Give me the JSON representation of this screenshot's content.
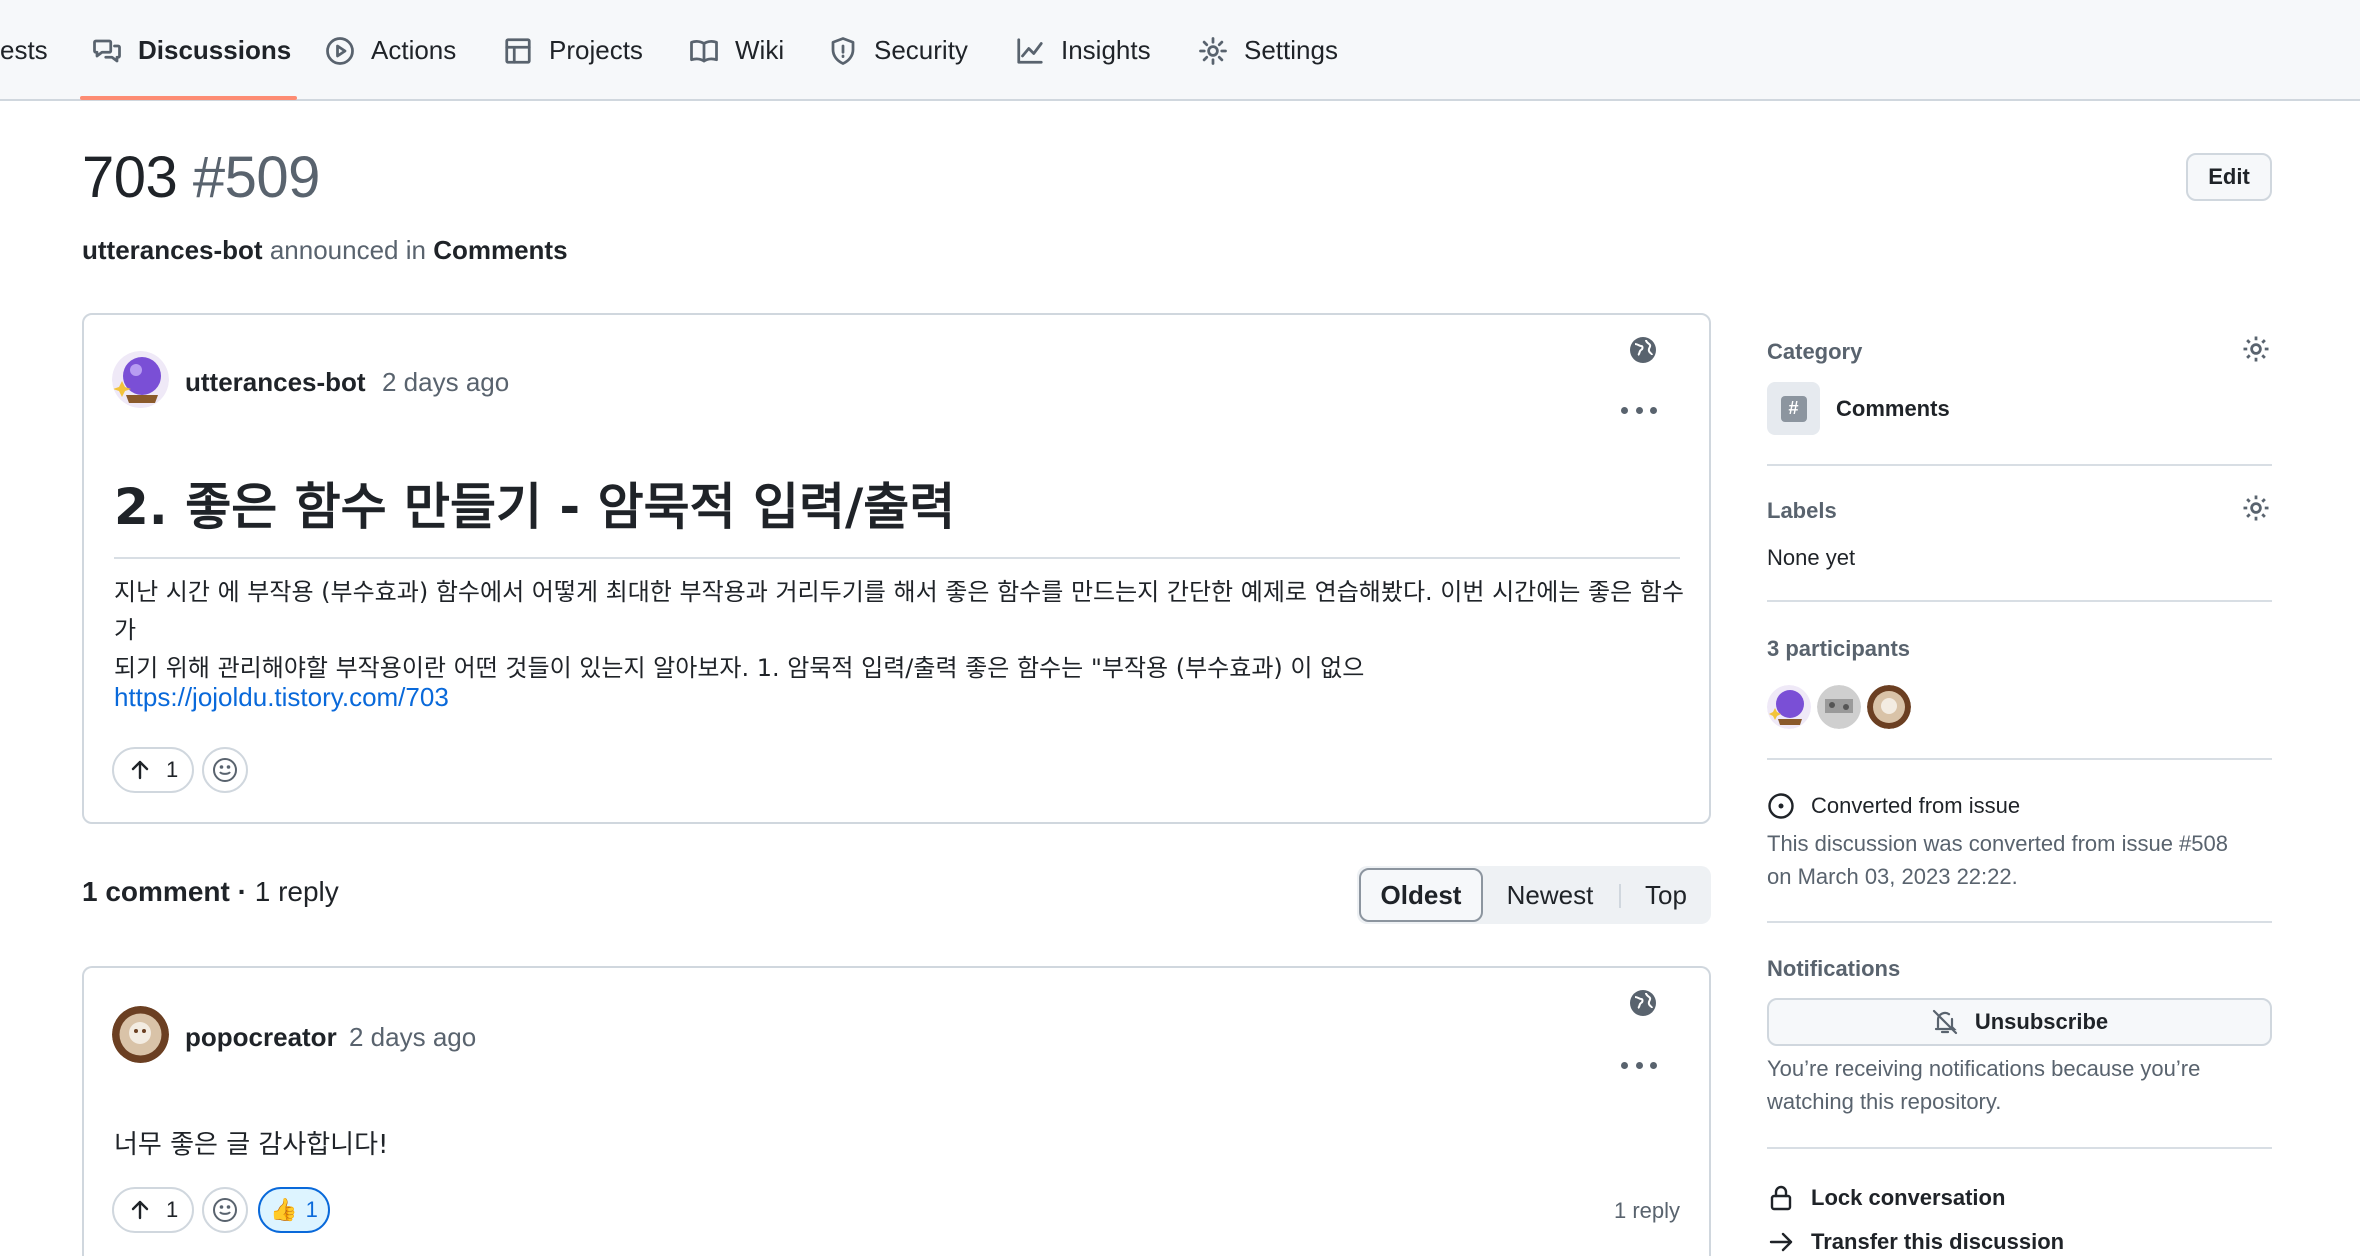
{
  "nav": {
    "items": [
      {
        "label": "ests",
        "icon": "none"
      },
      {
        "label": "Discussions",
        "icon": "comment-discussion-icon"
      },
      {
        "label": "Actions",
        "icon": "play-icon"
      },
      {
        "label": "Projects",
        "icon": "table-icon"
      },
      {
        "label": "Wiki",
        "icon": "book-icon"
      },
      {
        "label": "Security",
        "icon": "shield-icon"
      },
      {
        "label": "Insights",
        "icon": "graph-icon"
      },
      {
        "label": "Settings",
        "icon": "gear-icon"
      }
    ],
    "active": "Discussions"
  },
  "header": {
    "title": "703",
    "number": "#509",
    "edit_label": "Edit",
    "author": "utterances-bot",
    "announced_text": "announced in",
    "category": "Comments"
  },
  "post": {
    "author": "utterances-bot",
    "time": "2 days ago",
    "heading": "2. 좋은 함수 만들기 - 암묵적 입력/출력",
    "body_line1": "지난 시간 에 부작용 (부수효과) 함수에서 어떻게 최대한 부작용과 거리두기를 해서 좋은 함수를 만드는지 간단한 예제로 연습해봤다. 이번 시간에는 좋은 함수가",
    "body_line2": "되기 위해 관리해야할 부작용이란 어떤 것들이 있는지 알아보자. 1. 암묵적 입력/출력 좋은 함수는 \"부작용 (부수효과) 이 없으",
    "link": "https://jojoldu.tistory.com/703",
    "upvotes": "1"
  },
  "comments_header": {
    "count": "1 comment",
    "separator": "·",
    "replies": "1 reply",
    "sort_options": [
      "Oldest",
      "Newest",
      "Top"
    ],
    "active_sort": "Oldest"
  },
  "comment": {
    "author": "popocreator",
    "time": "2 days ago",
    "text": "너무 좋은 글 감사합니다!",
    "upvotes": "1",
    "thumbs_emoji": "👍",
    "thumbs_count": "1",
    "reply_count": "1 reply"
  },
  "sidebar": {
    "category_title": "Category",
    "category_icon_text": "#",
    "category_name": "Comments",
    "labels_title": "Labels",
    "labels_value": "None yet",
    "participants_title": "3 participants",
    "converted_title": "Converted from issue",
    "converted_text_line1": "This discussion was converted from issue #508",
    "converted_text_line2": "on March 03, 2023 22:22.",
    "notifications_title": "Notifications",
    "unsubscribe_label": "Unsubscribe",
    "notify_text_line1": "You’re receiving notifications because you’re",
    "notify_text_line2": "watching this repository.",
    "lock_label": "Lock conversation",
    "transfer_label": "Transfer this discussion"
  },
  "colors": {
    "accent": "#0969da",
    "nav_underline": "#fd8c73",
    "muted": "#59636e",
    "border": "#d0d7de"
  }
}
